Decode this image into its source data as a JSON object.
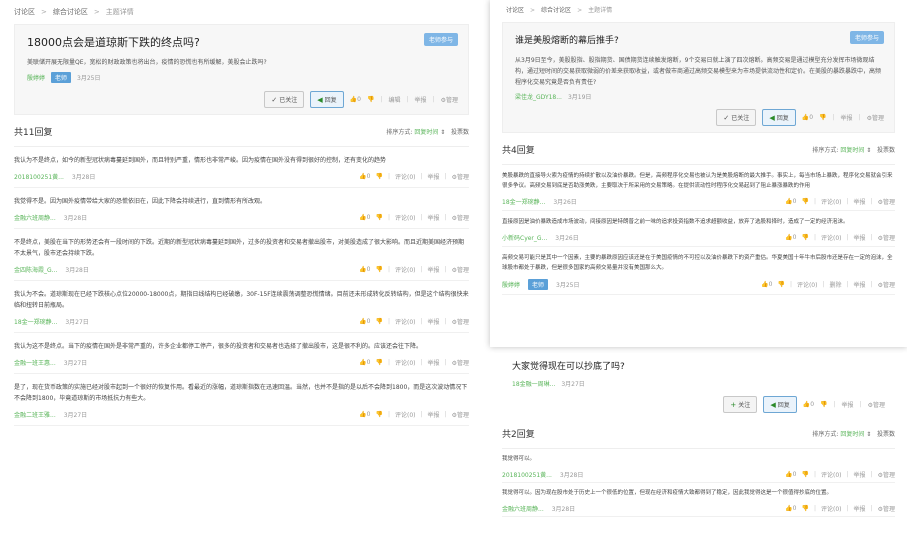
{
  "left": {
    "crumbs": [
      "讨论区",
      "综合讨论区",
      "主题详情"
    ],
    "topic": {
      "title": "18000点会是道琼斯下跌的终点吗?",
      "badge": "老师参与",
      "desc": "美联储开展无限量QE，宽松的财政政策也将出台，疫情的恐慌也有所缓解，美股会止跌吗?",
      "author": "殷婷婷",
      "tag": "老师",
      "date": "3月25日",
      "followed": "已关注",
      "reply_btn": "回复",
      "likes": "0",
      "edit": "编辑",
      "report": "举报",
      "manage": "管理"
    },
    "reply_count": "共11回复",
    "sort_label": "排序方式:",
    "sort_active": "回复时间",
    "sort_other": "投票数",
    "replies": [
      {
        "text": "我认为不是终点，如今的新型冠状病毒蔓延到国外，而且特别严重，情形也非常严峻。因为疫情在国外没有得到很好的控制，还有变化的趋势",
        "author": "2018100251黄...",
        "date": "3月28日"
      },
      {
        "text": "我觉得不是。因为国外疫情带给大家的恐慌依旧在，因此下降会持续进行，直到情形有所改观。",
        "author": "金融六班周静...",
        "date": "3月28日"
      },
      {
        "text": "不是终点，美股在当下的形势还会有一段时间的下跌。近期的新型冠状病毒蔓延到国外，过多的投资者和交易者撤出股市，对美股造成了很大影响。而且近期美国经济预期不太景气，股市还会持续下跌。",
        "author": "金四陈海霞_G...",
        "date": "3月28日"
      },
      {
        "text": "我认为不会。道琼斯现在已经下跌核心点位20000-18000点，期指日线结构已经破缴，30F-15F连续震荡调整恐慌情绪。目前还未形成转化反转结构，但是这个结构很快来临和扭转日前瓶局。",
        "author": "18金一郑琬静...",
        "date": "3月27日"
      },
      {
        "text": "我认为这不是终点。当下的疫情在国外是非常严重的，许多企业都停工停产，很多的投资者和交易者也选择了撤出股市，这是很不利的。应该还会往下降。",
        "author": "金融一班王惠...",
        "date": "3月27日"
      },
      {
        "text": "是了，现在货币政策的实施已经对股市起到一个很好的恢复作用。看最近的涨幅，道琼斯指数在迅速回温。当然，也并不是指的是以后不会降到1800，而是这次波动情况下不会降到1800，毕竟道琼斯的市场抵抗力有些大。",
        "author": "金融二班王雅...",
        "date": "3月27日"
      }
    ]
  },
  "tr": {
    "crumbs": [
      "讨论区",
      "综合讨论区",
      "主题详情"
    ],
    "topic": {
      "title": "谁是美股熔断的幕后推手?",
      "badge": "老师参与",
      "desc": "从3月9日至今，美股股指、股指期货、国债期货连续触发熔断，9个交易日就上演了四次熔断。高频交易是通过模型充分发挥市场微观结构，通过短时间的交易获取微弱的价差来获取收益，或者做市商通过高频交易模型来为市场提供流动性和定价。在美股的暴跌暴跌中，高频程序化交易究竟是否负有责任?",
      "author": "梁佳龙_GDY18...",
      "date": "3月19日",
      "followed": "已关注",
      "reply_btn": "回复",
      "likes": "0",
      "report": "举报",
      "manage": "管理"
    },
    "reply_count": "共4回复",
    "sort_label": "排序方式:",
    "sort_active": "回复时间",
    "sort_other": "投票数",
    "replies": [
      {
        "text": "美股暴跌的直接导火索为疫情的持续扩散以及油价暴跌。但是，高频程序化交易也被认为是美股熔断的最大推手。事实上，每当市场上暴跌，程序化交易就会引来很多争议。高频交易到底是否助涨美跌，主要取决于所采用的交易策略。在提供流动性时程序化交易起到了阻止暴涨暴跌的作用",
        "author": "18金一郑琬静...",
        "date": "3月26日"
      },
      {
        "text": "直接原因是油价暴跌造成市场波动，间接原因是特朗普之前一味的追求投资指数不追求超额收益，放弃了选股和择时，造成了一定的经济泡沫。",
        "author": "小新码Cyer_G...",
        "date": "3月26日"
      },
      {
        "text": "高频交易可能只是其中一个因素，主要的暴跌原因应该还是在于美国疫情的不可控以及油价暴跌下的资产重估。华夏美国十年牛市后股市还是存在一定的泡沫，全球股市都处于暴跌，但是很多国家的高频交易量并没有美国那么大。",
        "author": "殷婷婷",
        "date": "3月25日",
        "tag": "老师",
        "delete": "删除"
      }
    ]
  },
  "br": {
    "topic": {
      "title": "大家觉得现在可以抄底了吗?",
      "author": "18金融一周琳...",
      "date": "3月27日",
      "follow": "关注",
      "reply_btn": "回复",
      "likes": "0",
      "report": "举报",
      "manage": "管理"
    },
    "reply_count": "共2回复",
    "sort_label": "排序方式:",
    "sort_active": "回复时间",
    "sort_other": "投票数",
    "replies": [
      {
        "text": "我觉得可以。",
        "author": "2018100251黄...",
        "date": "3月28日"
      },
      {
        "text": "我觉得可以。因为现在股市处于历史上一个很低的位置，但现在经济和疫情大致都得到了稳定，因此我觉得这是一个很值得抄底的位置。",
        "author": "金融六班周静...",
        "date": "3月28日"
      }
    ]
  },
  "common": {
    "comment": "评论(0)",
    "report": "举报",
    "manage": "管理",
    "zero": "0"
  }
}
